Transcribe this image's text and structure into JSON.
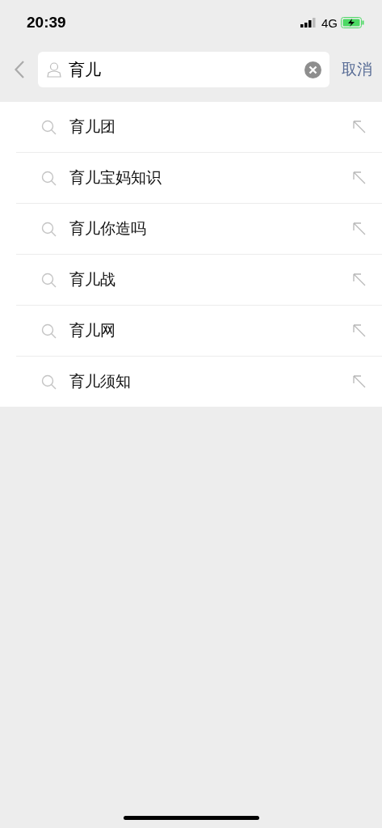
{
  "status_bar": {
    "time": "20:39",
    "network": "4G"
  },
  "search": {
    "value": "育儿",
    "cancel": "取消"
  },
  "suggestions": [
    {
      "text": "育儿团"
    },
    {
      "text": "育儿宝妈知识"
    },
    {
      "text": "育儿你造吗"
    },
    {
      "text": "育儿战"
    },
    {
      "text": "育儿网"
    },
    {
      "text": "育儿须知"
    }
  ]
}
